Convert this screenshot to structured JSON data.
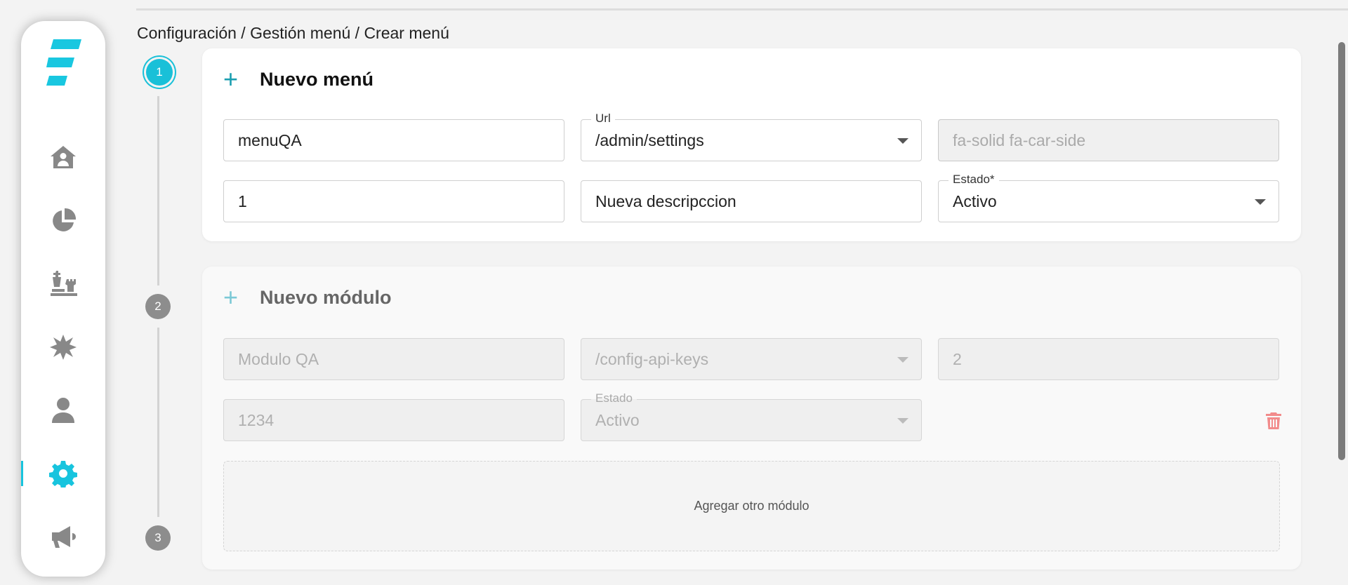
{
  "breadcrumb": "Configuración / Gestión menú / Crear menú",
  "sidebar": {
    "items": [
      {
        "icon": "home-user-icon",
        "active": false
      },
      {
        "icon": "pie-chart-icon",
        "active": false
      },
      {
        "icon": "chess-icon",
        "active": false
      },
      {
        "icon": "burst-icon",
        "active": false
      },
      {
        "icon": "user-icon",
        "active": false
      },
      {
        "icon": "gear-icon",
        "active": true
      },
      {
        "icon": "megaphone-icon",
        "active": false
      }
    ]
  },
  "stepper": {
    "steps": [
      "1",
      "2",
      "3"
    ],
    "active_step": "1"
  },
  "menu_card": {
    "title": "Nuevo menú",
    "name_value": "menuQA",
    "url_label": "Url",
    "url_value": "/admin/settings",
    "icon_value": "fa-solid fa-car-side",
    "order_value": "1",
    "description_value": "Nueva descripccion",
    "estado_label": "Estado*",
    "estado_value": "Activo"
  },
  "module_card": {
    "title": "Nuevo módulo",
    "name_value": "Modulo QA",
    "url_value": "/config-api-keys",
    "order_value": "2",
    "code_value": "1234",
    "estado_label": "Estado",
    "estado_value": "Activo",
    "add_module_label": "Agregar otro módulo"
  },
  "colors": {
    "accent": "#17c4de",
    "delete": "#f28b8b",
    "inactive_icon": "#888888"
  }
}
